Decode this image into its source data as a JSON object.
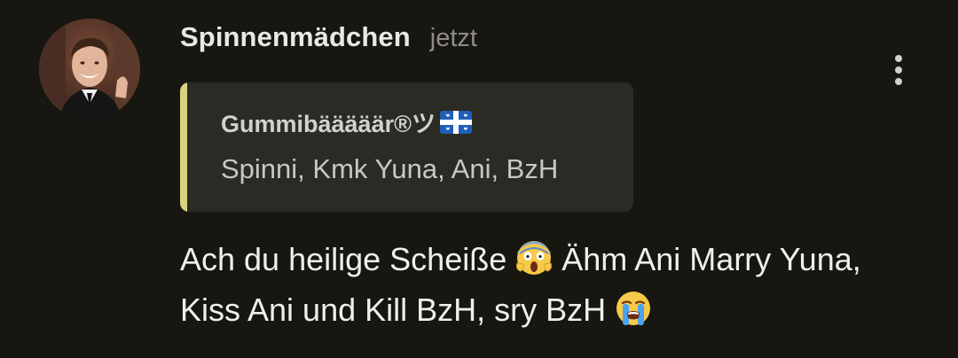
{
  "comment": {
    "author": "Spinnenmädchen",
    "time": "jetzt",
    "avatar_icon": "user-avatar-photo",
    "more_icon": "more-vertical-icon",
    "quote": {
      "author": "Gummibääääär®ツ",
      "author_flag_icon": "quebec-flag-emoji",
      "text": "Spinni, Kmk Yuna, Ani, BzH",
      "accent_color": "#d9d27f"
    },
    "message": {
      "part1": "Ach du heilige Scheiße ",
      "emoji1": "face-screaming-in-fear-emoji",
      "part2": " Ähm Ani Marry Yuna, Kiss Ani und Kill BzH, sry BzH ",
      "emoji2": "loudly-crying-face-emoji"
    }
  }
}
